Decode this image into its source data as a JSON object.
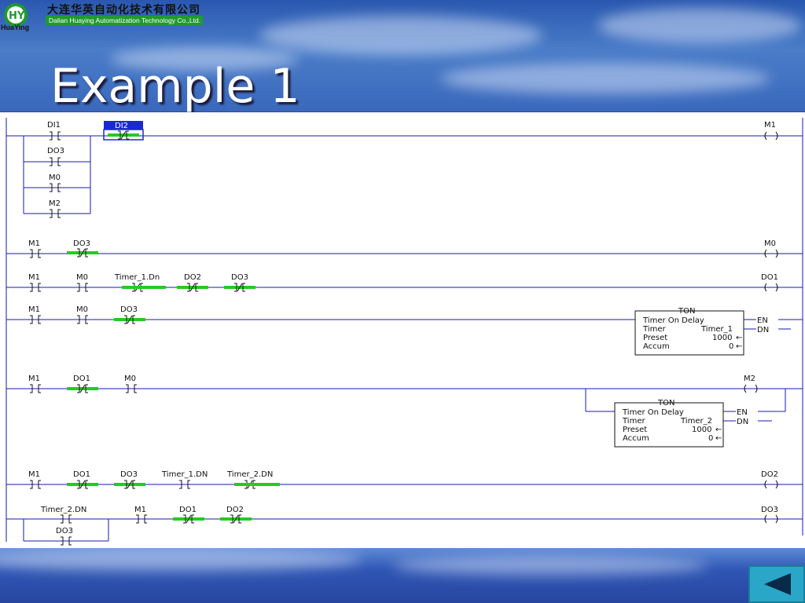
{
  "header": {
    "company_cn": "大连华英自动化技术有限公司",
    "company_en": "Dalian Huaying Automatization Technology Co.,Ltd.",
    "brand": "HuaYing",
    "logo_text": "HY"
  },
  "slide": {
    "title": "Example 1"
  },
  "rungs": [
    {
      "output": "M1",
      "contacts": [
        "DI1",
        "DI2"
      ],
      "branch": [
        "DO3",
        "M0",
        "M2"
      ]
    },
    {
      "output": "M0",
      "contacts": [
        "M1",
        "DO3"
      ]
    },
    {
      "output": "DO1",
      "contacts": [
        "M1",
        "M0",
        "Timer_1.Dn",
        "DO2",
        "DO3"
      ]
    },
    {
      "contacts": [
        "M1",
        "M0",
        "DO3"
      ],
      "timer": {
        "name": "TON",
        "desc": "Timer On Delay",
        "timer_label": "Timer",
        "timer_value": "Timer_1",
        "preset_label": "Preset",
        "preset_value": "1000",
        "accum_label": "Accum",
        "accum_value": "0",
        "en": "EN",
        "dn": "DN"
      }
    },
    {
      "output": "M2",
      "contacts": [
        "M1",
        "DO1",
        "M0"
      ],
      "timer": {
        "name": "TON",
        "desc": "Timer On Delay",
        "timer_label": "Timer",
        "timer_value": "Timer_2",
        "preset_label": "Preset",
        "preset_value": "1000",
        "accum_label": "Accum",
        "accum_value": "0",
        "en": "EN",
        "dn": "DN"
      }
    },
    {
      "output": "DO2",
      "contacts": [
        "M1",
        "DO1",
        "DO3",
        "Timer_1.DN",
        "Timer_2.DN"
      ]
    },
    {
      "output": "DO3",
      "contacts": [
        "Timer_2.DN",
        "M1",
        "DO1",
        "DO2"
      ],
      "branch": [
        "DO3"
      ]
    }
  ],
  "colors": {
    "rail": "#1a1ab0",
    "energized": "#22cc22",
    "selected": "#1a2ad0"
  },
  "nav": {
    "icon": "back-arrow-icon"
  }
}
